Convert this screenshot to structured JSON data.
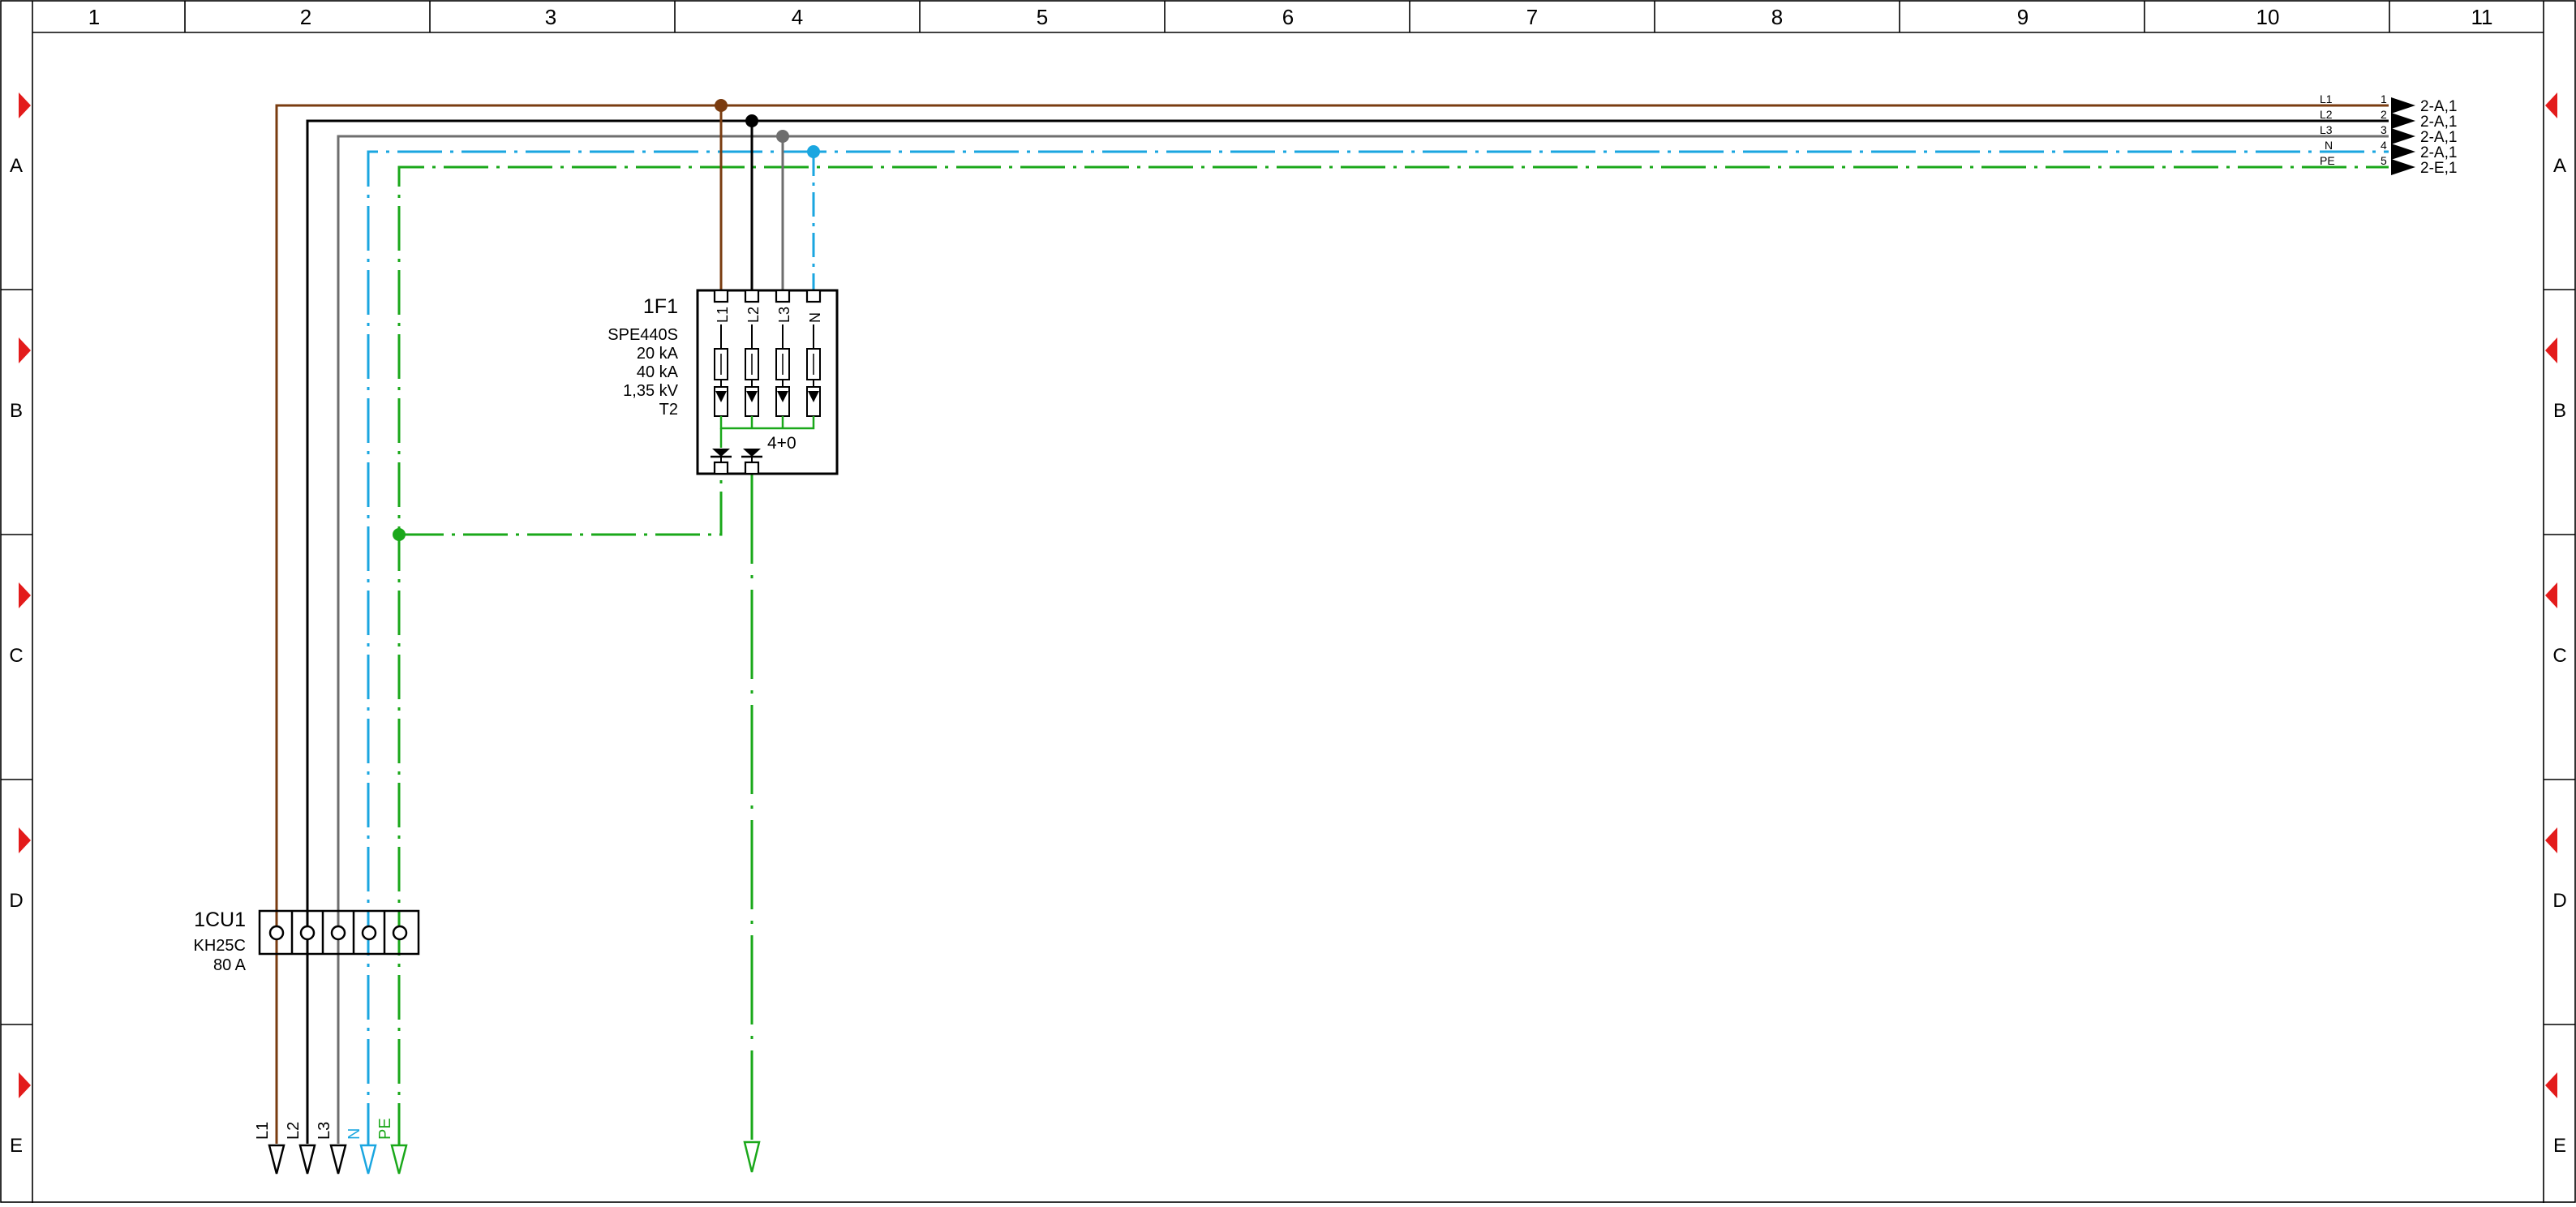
{
  "colors": {
    "L1": "#7a3c10",
    "L2": "#000000",
    "L3": "#6e6e6e",
    "N": "#1aa6e0",
    "PE": "#1aa81a",
    "marker": "#e31b1b"
  },
  "frame": {
    "columns": [
      "1",
      "2",
      "3",
      "4",
      "5",
      "6",
      "7",
      "8",
      "9",
      "10",
      "11"
    ],
    "rows": [
      "A",
      "B",
      "C",
      "D",
      "E"
    ]
  },
  "surge_protector": {
    "tag": "1F1",
    "specs": [
      "SPE440S",
      "20 kA",
      "40 kA",
      "1,35 kV",
      "T2"
    ],
    "terminals": [
      "L1",
      "L2",
      "L3",
      "N"
    ],
    "config": "4+0"
  },
  "terminal_block": {
    "tag": "1CU1",
    "specs": [
      "KH25C",
      "80 A"
    ]
  },
  "bottom_labels": [
    "L1",
    "L2",
    "L3",
    "N",
    "PE"
  ],
  "outgoing": {
    "conductors": [
      "L1",
      "L2",
      "L3",
      "N",
      "PE"
    ],
    "numbers": [
      "1",
      "2",
      "3",
      "4",
      "5"
    ],
    "refs": [
      "2-A,1",
      "2-A,1",
      "2-A,1",
      "2-A,1",
      "2-E,1"
    ]
  }
}
